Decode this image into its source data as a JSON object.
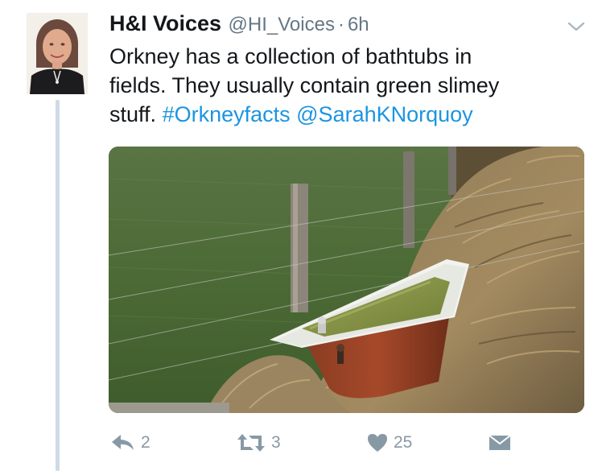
{
  "tweet": {
    "author_name": "H&I Voices",
    "handle": "@HI_Voices",
    "separator": "·",
    "time": "6h",
    "text_lines": [
      "Orkney has a collection of bathtubs in",
      "fields. They usually contain green slimey",
      "stuff."
    ],
    "hashtag": "#Orkneyfacts",
    "mention": "@SarahKNorquoy",
    "media_description_icon": "photo-bathtub-in-field"
  },
  "actions": {
    "reply_count": "2",
    "retweet_count": "3",
    "like_count": "25"
  },
  "icons": {
    "reply": "reply-icon",
    "retweet": "retweet-icon",
    "like": "heart-icon",
    "dm": "envelope-icon",
    "menu": "chevron-down-icon"
  },
  "colors": {
    "text": "#14171a",
    "secondary": "#657786",
    "link": "#1b95e0",
    "action": "#8899a6",
    "thread": "#cfdbe4"
  }
}
